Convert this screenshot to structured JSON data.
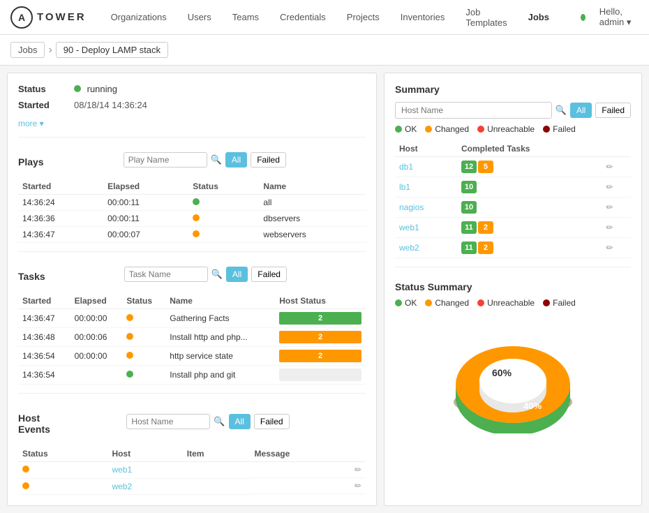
{
  "header": {
    "logo_letter": "A",
    "logo_text": "TOWER",
    "nav_items": [
      {
        "label": "Organizations",
        "active": false
      },
      {
        "label": "Users",
        "active": false
      },
      {
        "label": "Teams",
        "active": false
      },
      {
        "label": "Credentials",
        "active": false
      },
      {
        "label": "Projects",
        "active": false
      },
      {
        "label": "Inventories",
        "active": false
      },
      {
        "label": "Job Templates",
        "active": false
      },
      {
        "label": "Jobs",
        "active": true
      }
    ],
    "user_greeting": "Hello, admin",
    "status_dot_color": "#4caf50"
  },
  "breadcrumb": {
    "jobs_label": "Jobs",
    "current_label": "90 - Deploy LAMP stack"
  },
  "left_panel": {
    "status_label": "Status",
    "status_value": "running",
    "started_label": "Started",
    "started_value": "08/18/14 14:36:24",
    "more_label": "more ▾",
    "plays_section": {
      "title": "Plays",
      "search_placeholder": "Play Name",
      "filter_all": "All",
      "filter_failed": "Failed",
      "columns": [
        "Started",
        "Elapsed",
        "Status",
        "Name"
      ],
      "rows": [
        {
          "started": "14:36:24",
          "elapsed": "00:00:11",
          "status": "green",
          "name": "all"
        },
        {
          "started": "14:36:36",
          "elapsed": "00:00:11",
          "status": "orange",
          "name": "dbservers"
        },
        {
          "started": "14:36:47",
          "elapsed": "00:00:07",
          "status": "orange",
          "name": "webservers"
        }
      ]
    },
    "tasks_section": {
      "title": "Tasks",
      "search_placeholder": "Task Name",
      "filter_all": "All",
      "filter_failed": "Failed",
      "columns": [
        "Started",
        "Elapsed",
        "Status",
        "Name",
        "Host Status"
      ],
      "rows": [
        {
          "started": "14:36:47",
          "elapsed": "00:00:00",
          "status": "orange",
          "name": "Gathering Facts",
          "bar_green": 2,
          "bar_orange": 0,
          "bar_total": 2,
          "bar_type": "green_full"
        },
        {
          "started": "14:36:48",
          "elapsed": "00:00:06",
          "status": "orange",
          "name": "Install http and php...",
          "bar_green": 2,
          "bar_orange": 0,
          "bar_total": 2,
          "bar_type": "orange_partial"
        },
        {
          "started": "14:36:54",
          "elapsed": "00:00:00",
          "status": "orange",
          "name": "http service state",
          "bar_green": 2,
          "bar_orange": 0,
          "bar_total": 2,
          "bar_type": "orange_partial"
        },
        {
          "started": "14:36:54",
          "elapsed": "",
          "status": "green",
          "name": "Install php and git",
          "bar_type": "empty"
        }
      ]
    },
    "host_events_section": {
      "title": "Host Events",
      "search_placeholder": "Host Name",
      "filter_all": "All",
      "filter_failed": "Failed",
      "columns": [
        "Status",
        "Host",
        "Item",
        "Message"
      ],
      "rows": [
        {
          "status": "orange",
          "host": "web1",
          "item": "",
          "message": ""
        },
        {
          "status": "orange",
          "host": "web2",
          "item": "",
          "message": ""
        }
      ]
    }
  },
  "right_panel": {
    "summary_title": "Summary",
    "search_placeholder": "Host Name",
    "filter_all": "All",
    "filter_failed": "Failed",
    "legend": [
      {
        "label": "OK",
        "color": "#4caf50"
      },
      {
        "label": "Changed",
        "color": "#ff9800"
      },
      {
        "label": "Unreachable",
        "color": "#f44336"
      },
      {
        "label": "Failed",
        "color": "#8b0000"
      }
    ],
    "summary_columns": [
      "Host",
      "Completed Tasks"
    ],
    "summary_rows": [
      {
        "host": "db1",
        "ok": 12,
        "changed": 5,
        "show_changed": true
      },
      {
        "host": "lb1",
        "ok": 10,
        "changed": 0,
        "show_changed": false
      },
      {
        "host": "nagios",
        "ok": 10,
        "changed": 0,
        "show_changed": false
      },
      {
        "host": "web1",
        "ok": 11,
        "changed": 2,
        "show_changed": true
      },
      {
        "host": "web2",
        "ok": 11,
        "changed": 2,
        "show_changed": true
      }
    ],
    "status_summary_title": "Status Summary",
    "status_summary_legend": [
      {
        "label": "OK",
        "color": "#4caf50"
      },
      {
        "label": "Changed",
        "color": "#ff9800"
      },
      {
        "label": "Unreachable",
        "color": "#f44336"
      },
      {
        "label": "Failed",
        "color": "#8b0000"
      }
    ],
    "donut_green_pct": 40,
    "donut_orange_pct": 60,
    "donut_green_label": "40%",
    "donut_orange_label": "60%"
  }
}
